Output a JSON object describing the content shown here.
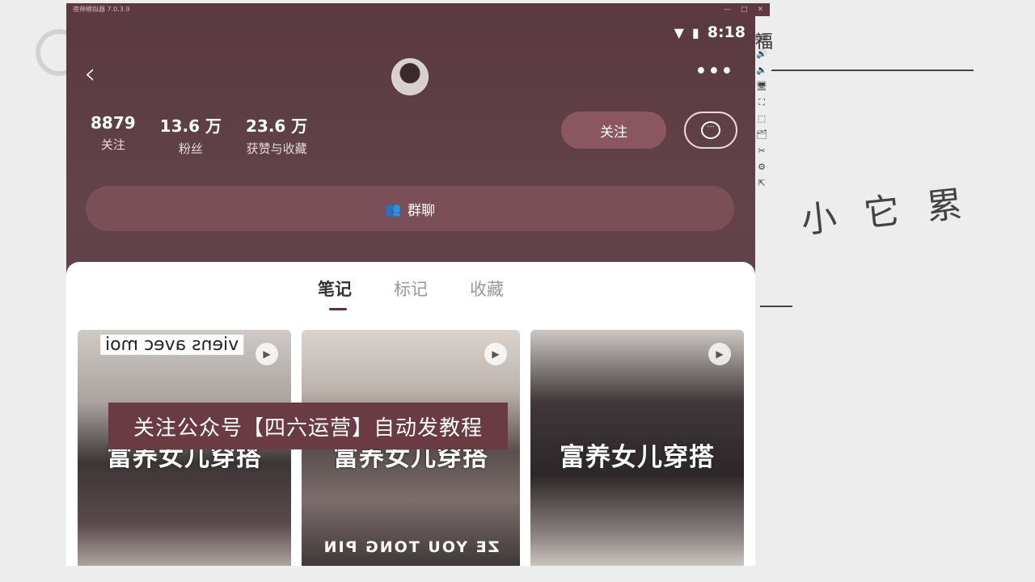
{
  "emulator": {
    "title": "夜神模拟器 7.0.3.9",
    "controls": [
      "—",
      "□",
      "✕"
    ],
    "sidebar_icons": [
      "⌨",
      "🔊",
      "🔈",
      "🖥",
      "⛶",
      "⬚",
      "🗂",
      "✂",
      "⚙",
      "⇱"
    ]
  },
  "status_bar": {
    "time": "8:18",
    "wifi": "▼",
    "battery": "▮"
  },
  "profile": {
    "back": "‹",
    "more": "•••",
    "stats": [
      {
        "num": "8879",
        "label": "关注"
      },
      {
        "num": "13.6 万",
        "label": "粉丝"
      },
      {
        "num": "23.6 万",
        "label": "获赞与收藏"
      }
    ],
    "follow_label": "关注",
    "message_icon": "···",
    "group_chat_label": "群聊"
  },
  "tabs": [
    {
      "label": "笔记",
      "active": true
    },
    {
      "label": "标记",
      "active": false
    },
    {
      "label": "收藏",
      "active": false
    }
  ],
  "cards": [
    {
      "caption": "富养女儿穿搭",
      "sign": "viens avec moi",
      "bottom": ""
    },
    {
      "caption": "富养女儿穿搭",
      "sign": "",
      "bottom": "ZE YOU TONG PIN"
    },
    {
      "caption": "富养女儿穿搭",
      "sign": "",
      "bottom": ""
    }
  ],
  "overlay": "关注公众号【四六运营】自动发教程",
  "whiteboard": {
    "right_text": "福",
    "scribble": "小 它 累"
  }
}
